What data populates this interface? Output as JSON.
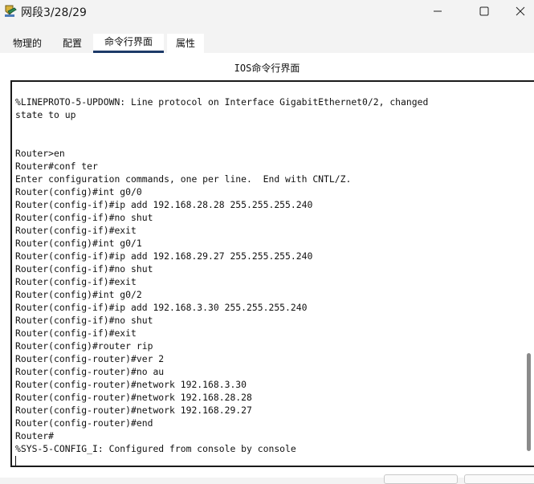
{
  "window": {
    "title": "网段3/28/29",
    "icon": "router-app-icon",
    "controls": [
      "minimize-icon",
      "maximize-icon",
      "close-icon"
    ]
  },
  "tabs": [
    {
      "label": "物理的"
    },
    {
      "label": "配置"
    },
    {
      "label": "命令行界面",
      "selected": true
    },
    {
      "label": "属性"
    }
  ],
  "panel": {
    "heading": "IOS命令行界面"
  },
  "terminal": {
    "lines": [
      "%LINEPROTO-5-UPDOWN: Line protocol on Interface GigabitEthernet0/2, changed",
      "state to up",
      "",
      "",
      "Router>en",
      "Router#conf ter",
      "Enter configuration commands, one per line.  End with CNTL/Z.",
      "Router(config)#int g0/0",
      "Router(config-if)#ip add 192.168.28.28 255.255.255.240",
      "Router(config-if)#no shut",
      "Router(config-if)#exit",
      "Router(config)#int g0/1",
      "Router(config-if)#ip add 192.168.29.27 255.255.255.240",
      "Router(config-if)#no shut",
      "Router(config-if)#exit",
      "Router(config)#int g0/2",
      "Router(config-if)#ip add 192.168.3.30 255.255.255.240",
      "Router(config-if)#no shut",
      "Router(config-if)#exit",
      "Router(config)#router rip",
      "Router(config-router)#ver 2",
      "Router(config-router)#no au",
      "Router(config-router)#network 192.168.3.30",
      "Router(config-router)#network 192.168.28.28",
      "Router(config-router)#network 192.168.29.27",
      "Router(config-router)#end",
      "Router#",
      "%SYS-5-CONFIG_I: Configured from console by console"
    ]
  },
  "colors": {
    "tab_underline": "#1d3a68",
    "terminal_border": "#1a1a1a",
    "scrollbar_thumb": "#8a8a8a"
  }
}
